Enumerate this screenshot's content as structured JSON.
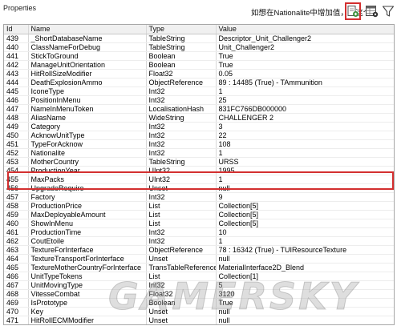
{
  "panel": {
    "title": "Properties"
  },
  "annotation": "如想在Nationalite中增加值，用这个",
  "toolbar": {
    "add_icon": "add-document-icon",
    "sheet_icon": "spreadsheet-icon",
    "filter_icon": "funnel-filter-icon",
    "highlight_color": "#d32f2f"
  },
  "table": {
    "headers": [
      "Id",
      "Name",
      "Type",
      "Value"
    ],
    "rows": [
      [
        "439",
        "_ShortDatabaseName",
        "TableString",
        "Descriptor_Unit_Challenger2"
      ],
      [
        "440",
        "ClassNameForDebug",
        "TableString",
        "Unit_Challenger2"
      ],
      [
        "441",
        "StickToGround",
        "Boolean",
        "True"
      ],
      [
        "442",
        "ManageUnitOrientation",
        "Boolean",
        "True"
      ],
      [
        "443",
        "HitRollSizeModifier",
        "Float32",
        "0.05"
      ],
      [
        "444",
        "DeathExplosionAmmo",
        "ObjectReference",
        "89 : 14485 (True) - TAmmunition"
      ],
      [
        "445",
        "IconeType",
        "Int32",
        "1"
      ],
      [
        "446",
        "PositionInMenu",
        "Int32",
        "25"
      ],
      [
        "447",
        "NameInMenuToken",
        "LocalisationHash",
        "831FC766DB000000"
      ],
      [
        "448",
        "AliasName",
        "WideString",
        "CHALLENGER 2"
      ],
      [
        "449",
        "Category",
        "Int32",
        "3"
      ],
      [
        "450",
        "AcknowUnitType",
        "Int32",
        "22"
      ],
      [
        "451",
        "TypeForAcknow",
        "Int32",
        "108"
      ],
      [
        "452",
        "Nationalite",
        "Int32",
        "1"
      ],
      [
        "453",
        "MotherCountry",
        "TableString",
        "URSS"
      ],
      [
        "454",
        "ProductionYear",
        "UInt32",
        "1995"
      ],
      [
        "455",
        "MaxPacks",
        "UInt32",
        "1"
      ],
      [
        "456",
        "UpgradeRequire",
        "Unset",
        "null"
      ],
      [
        "457",
        "Factory",
        "Int32",
        "9"
      ],
      [
        "458",
        "ProductionPrice",
        "List",
        "Collection[5]"
      ],
      [
        "459",
        "MaxDeployableAmount",
        "List",
        "Collection[5]"
      ],
      [
        "460",
        "ShowInMenu",
        "List",
        "Collection[5]"
      ],
      [
        "461",
        "ProductionTime",
        "Int32",
        "10"
      ],
      [
        "462",
        "CoutEtoile",
        "Int32",
        "1"
      ],
      [
        "463",
        "TextureForInterface",
        "ObjectReference",
        "78 : 16342 (True) - TUIResourceTexture"
      ],
      [
        "464",
        "TextureTransportForInterface",
        "Unset",
        "null"
      ],
      [
        "465",
        "TextureMotherCountryForInterface",
        "TransTableReference",
        "MaterialInterface2D_Blend"
      ],
      [
        "466",
        "UnitTypeTokens",
        "List",
        "Collection[1]"
      ],
      [
        "467",
        "UnitMovingType",
        "Int32",
        "5"
      ],
      [
        "468",
        "VitesseCombat",
        "Float32",
        "3120"
      ],
      [
        "469",
        "IsPrototype",
        "Boolean",
        "True"
      ],
      [
        "470",
        "Key",
        "Unset",
        "null"
      ],
      [
        "471",
        "HitRollECMModifier",
        "Unset",
        "null"
      ]
    ]
  },
  "watermark": "GAMERSKY"
}
